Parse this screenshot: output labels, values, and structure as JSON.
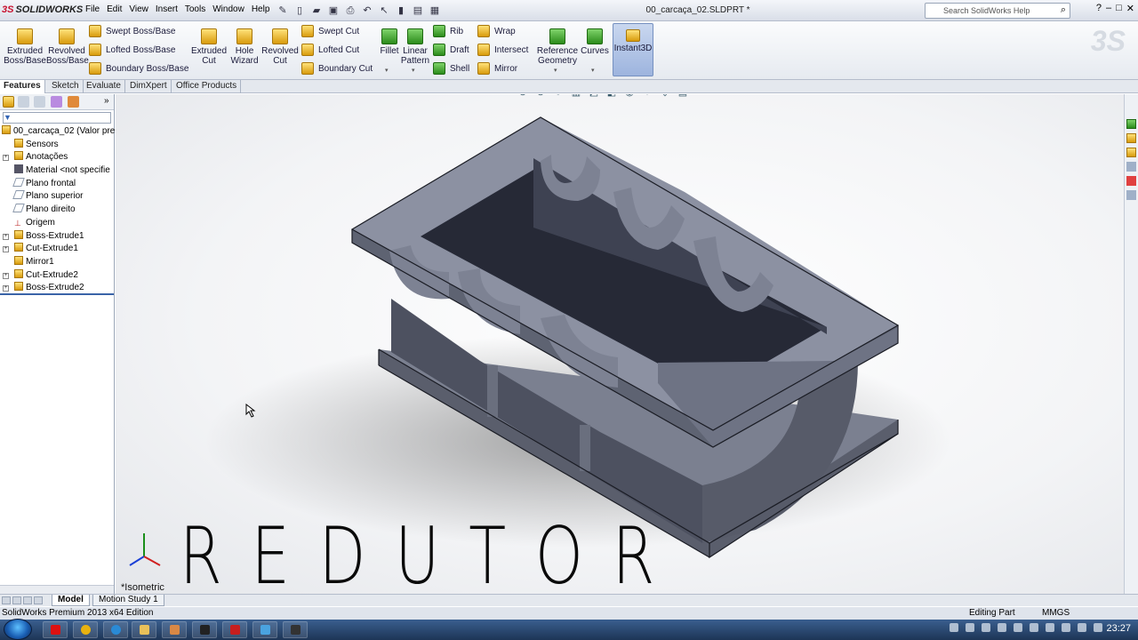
{
  "app": {
    "brand": "SOLIDWORKS",
    "document_title": "00_carcaça_02.SLDPRT *",
    "menu": [
      "File",
      "Edit",
      "View",
      "Insert",
      "Tools",
      "Window",
      "Help"
    ],
    "search_placeholder": "Search SolidWorks Help"
  },
  "ribbon": {
    "extruded_boss": "Extruded Boss/Base",
    "revolved_boss": "Revolved Boss/Base",
    "swept_boss": "Swept Boss/Base",
    "lofted_boss": "Lofted Boss/Base",
    "boundary_boss": "Boundary Boss/Base",
    "extruded_cut": "Extruded Cut",
    "hole_wizard": "Hole Wizard",
    "revolved_cut": "Revolved Cut",
    "swept_cut": "Swept Cut",
    "lofted_cut": "Lofted Cut",
    "boundary_cut": "Boundary Cut",
    "fillet": "Fillet",
    "linear_pattern": "Linear Pattern",
    "rib": "Rib",
    "draft": "Draft",
    "shell": "Shell",
    "wrap": "Wrap",
    "intersect": "Intersect",
    "mirror": "Mirror",
    "reference_geometry": "Reference Geometry",
    "curves": "Curves",
    "instant3d": "Instant3D"
  },
  "command_tabs": [
    "Features",
    "Sketch",
    "Evaluate",
    "DimXpert",
    "Office Products"
  ],
  "feature_tree": [
    {
      "label": "00_carcaça_02  (Valor pre",
      "expandable": false,
      "icon": "part-icon"
    },
    {
      "label": "Sensors",
      "expandable": false,
      "icon": "folder-icon"
    },
    {
      "label": "Anotações",
      "expandable": true,
      "icon": "annotations-icon"
    },
    {
      "label": "Material <not specifie",
      "expandable": false,
      "icon": "material-icon"
    },
    {
      "label": "Plano frontal",
      "expandable": false,
      "icon": "plane-icon"
    },
    {
      "label": "Plano superior",
      "expandable": false,
      "icon": "plane-icon"
    },
    {
      "label": "Plano direito",
      "expandable": false,
      "icon": "plane-icon"
    },
    {
      "label": "Origem",
      "expandable": false,
      "icon": "origin-icon"
    },
    {
      "label": "Boss-Extrude1",
      "expandable": true,
      "icon": "feature-icon"
    },
    {
      "label": "Cut-Extrude1",
      "expandable": true,
      "icon": "feature-icon"
    },
    {
      "label": "Mirror1",
      "expandable": false,
      "icon": "feature-icon"
    },
    {
      "label": "Cut-Extrude2",
      "expandable": true,
      "icon": "feature-icon"
    },
    {
      "label": "Boss-Extrude2",
      "expandable": true,
      "icon": "feature-icon"
    }
  ],
  "viewport": {
    "overlay_title": "REDUTOR",
    "view_name": "*Isometric"
  },
  "bottom_tabs": [
    "Model",
    "Motion Study 1"
  ],
  "status": {
    "edition": "SolidWorks Premium 2013 x64 Edition",
    "mode": "Editing Part",
    "units": "MMGS"
  },
  "taskbar": {
    "clock": "23:27"
  }
}
